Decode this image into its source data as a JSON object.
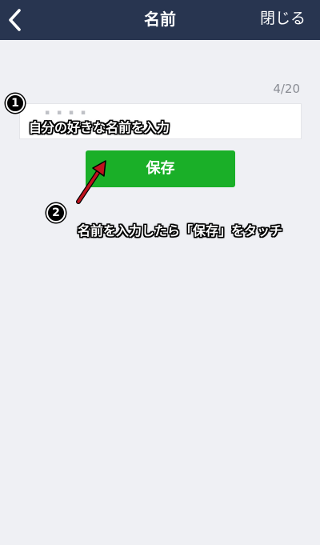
{
  "header": {
    "title": "名前",
    "close_label": "閉じる",
    "back_icon": "chevron-left-icon"
  },
  "form": {
    "counter": "4/20",
    "name_value": "",
    "ghost_text": "▪ ▪ ▪ ▪"
  },
  "save_button": {
    "label": "保存"
  },
  "annotations": {
    "step1_number": "1",
    "step1_text": "自分の好きな名前を入力",
    "step2_number": "2",
    "step2_text": "名前を入力したら「保存」をタッチ"
  },
  "colors": {
    "header_bg": "#283550",
    "page_bg": "#eff0f4",
    "save_button": "#1aaf28",
    "arrow": "#c0121e"
  }
}
